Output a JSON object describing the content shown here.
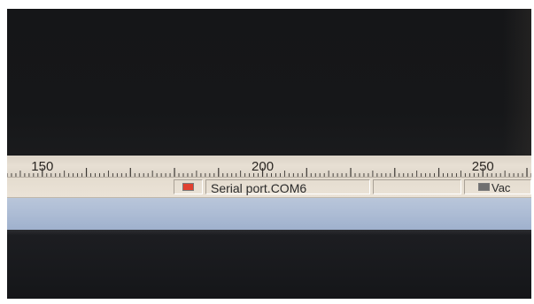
{
  "ruler": {
    "labels": [
      "150",
      "200",
      "250"
    ],
    "start_value": 142,
    "end_value": 261
  },
  "status_bar": {
    "serial_port_label": "Serial port.COM6",
    "serial_indicator_color": "#e04030",
    "vac_label": "Vac",
    "vac_indicator_color": "#707070"
  }
}
